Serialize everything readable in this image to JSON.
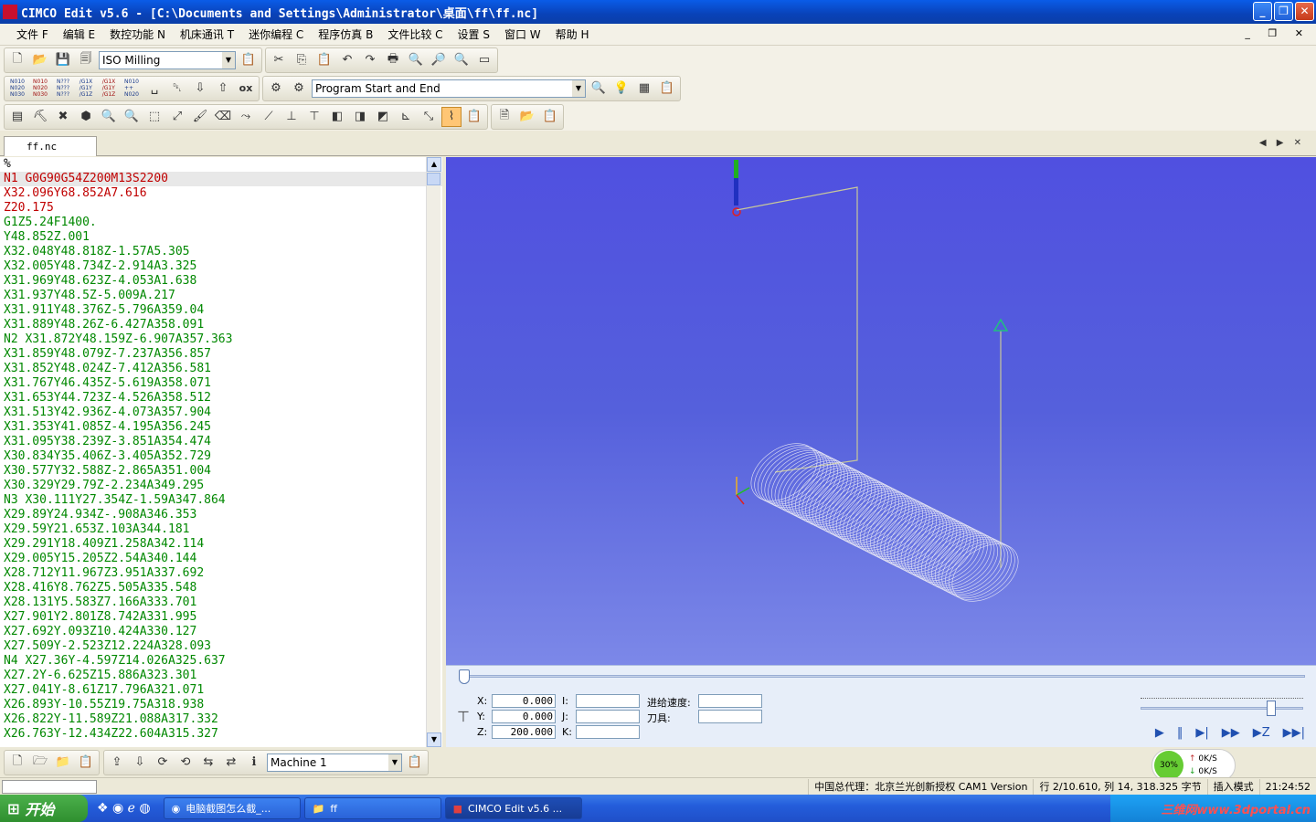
{
  "window": {
    "title": "CIMCO Edit v5.6 - [C:\\Documents and Settings\\Administrator\\桌面\\ff\\ff.nc]",
    "minimize": "_",
    "maximize": "❐",
    "close": "✕"
  },
  "menu": {
    "items": [
      "文件 F",
      "编辑 E",
      "数控功能 N",
      "机床通讯 T",
      "迷你编程 C",
      "程序仿真 B",
      "文件比较 C",
      "设置 S",
      "窗口 W",
      "帮助 H"
    ],
    "mdi_controls": "_ ❐ ✕"
  },
  "toolbar1": {
    "mode_select": "ISO Milling"
  },
  "toolbar2": {
    "nc_labels": [
      "N010\nN020\nN030",
      "N010\nN020\nN030",
      "N???\nN???\nN???",
      "/G1X\n/G1Y\n/G1Z",
      "/G1X\n/G1Y\n/G1Z",
      "N010\n++\nN020"
    ],
    "ox_label": "ox",
    "program_select": "Program Start and End"
  },
  "tabs": {
    "doc_tab": "ff.nc",
    "nav": "◀ ▶ ✕"
  },
  "editor": {
    "lines": [
      {
        "text": "%",
        "color": "black"
      },
      {
        "text": "N1 G0G90G54Z200M13S2200",
        "color": "red",
        "highlight": true
      },
      {
        "text": "X32.096Y68.852A7.616",
        "color": "red"
      },
      {
        "text": "Z20.175",
        "color": "red"
      },
      {
        "text": "G1Z5.24F1400.",
        "color": "green"
      },
      {
        "text": "Y48.852Z.001",
        "color": "green"
      },
      {
        "text": "X32.048Y48.818Z-1.57A5.305",
        "color": "green"
      },
      {
        "text": "X32.005Y48.734Z-2.914A3.325",
        "color": "green"
      },
      {
        "text": "X31.969Y48.623Z-4.053A1.638",
        "color": "green"
      },
      {
        "text": "X31.937Y48.5Z-5.009A.217",
        "color": "green"
      },
      {
        "text": "X31.911Y48.376Z-5.796A359.04",
        "color": "green"
      },
      {
        "text": "X31.889Y48.26Z-6.427A358.091",
        "color": "green"
      },
      {
        "text": "N2 X31.872Y48.159Z-6.907A357.363",
        "color": "green"
      },
      {
        "text": "X31.859Y48.079Z-7.237A356.857",
        "color": "green"
      },
      {
        "text": "X31.852Y48.024Z-7.412A356.581",
        "color": "green"
      },
      {
        "text": "X31.767Y46.435Z-5.619A358.071",
        "color": "green"
      },
      {
        "text": "X31.653Y44.723Z-4.526A358.512",
        "color": "green"
      },
      {
        "text": "X31.513Y42.936Z-4.073A357.904",
        "color": "green"
      },
      {
        "text": "X31.353Y41.085Z-4.195A356.245",
        "color": "green"
      },
      {
        "text": "X31.095Y38.239Z-3.851A354.474",
        "color": "green"
      },
      {
        "text": "X30.834Y35.406Z-3.405A352.729",
        "color": "green"
      },
      {
        "text": "X30.577Y32.588Z-2.865A351.004",
        "color": "green"
      },
      {
        "text": "X30.329Y29.79Z-2.234A349.295",
        "color": "green"
      },
      {
        "text": "N3 X30.111Y27.354Z-1.59A347.864",
        "color": "green"
      },
      {
        "text": "X29.89Y24.934Z-.908A346.353",
        "color": "green"
      },
      {
        "text": "X29.59Y21.653Z.103A344.181",
        "color": "green"
      },
      {
        "text": "X29.291Y18.409Z1.258A342.114",
        "color": "green"
      },
      {
        "text": "X29.005Y15.205Z2.54A340.144",
        "color": "green"
      },
      {
        "text": "X28.712Y11.967Z3.951A337.692",
        "color": "green"
      },
      {
        "text": "X28.416Y8.762Z5.505A335.548",
        "color": "green"
      },
      {
        "text": "X28.131Y5.583Z7.166A333.701",
        "color": "green"
      },
      {
        "text": "X27.901Y2.801Z8.742A331.995",
        "color": "green"
      },
      {
        "text": "X27.692Y.093Z10.424A330.127",
        "color": "green"
      },
      {
        "text": "X27.509Y-2.523Z12.224A328.093",
        "color": "green"
      },
      {
        "text": "N4 X27.36Y-4.597Z14.026A325.637",
        "color": "green"
      },
      {
        "text": "X27.2Y-6.625Z15.886A323.301",
        "color": "green"
      },
      {
        "text": "X27.041Y-8.61Z17.796A321.071",
        "color": "green"
      },
      {
        "text": "X26.893Y-10.55Z19.75A318.938",
        "color": "green"
      },
      {
        "text": "X26.822Y-11.589Z21.088A317.332",
        "color": "green"
      },
      {
        "text": "X26.763Y-12.434Z22.604A315.327",
        "color": "green"
      }
    ]
  },
  "simulation": {
    "x_label": "X:",
    "x_value": "0.000",
    "y_label": "Y:",
    "y_value": "0.000",
    "z_label": "Z:",
    "z_value": "200.000",
    "i_label": "I:",
    "j_label": "J:",
    "k_label": "K:",
    "feed_label": "进给速度:",
    "tool_label": "刀具:",
    "progress_fraction": 0.0,
    "speed_fraction": 0.82
  },
  "bottom_toolbar": {
    "machine_select": "Machine 1"
  },
  "speed_widget": {
    "percent": "30%",
    "up": "0K/S",
    "down": "0K/S"
  },
  "status": {
    "agent": "中国总代理：北京兰光创新授权 CAM1 Version",
    "position": "行 2/10.610, 列 14, 318.325 字节",
    "mode": "插入模式",
    "time": "21:24:52"
  },
  "taskbar": {
    "start": "开始",
    "tasks": [
      "电脑截图怎么截_...",
      "ff",
      "CIMCO Edit v5.6 ..."
    ],
    "watermark": "三维网www.3dportal.cn"
  }
}
